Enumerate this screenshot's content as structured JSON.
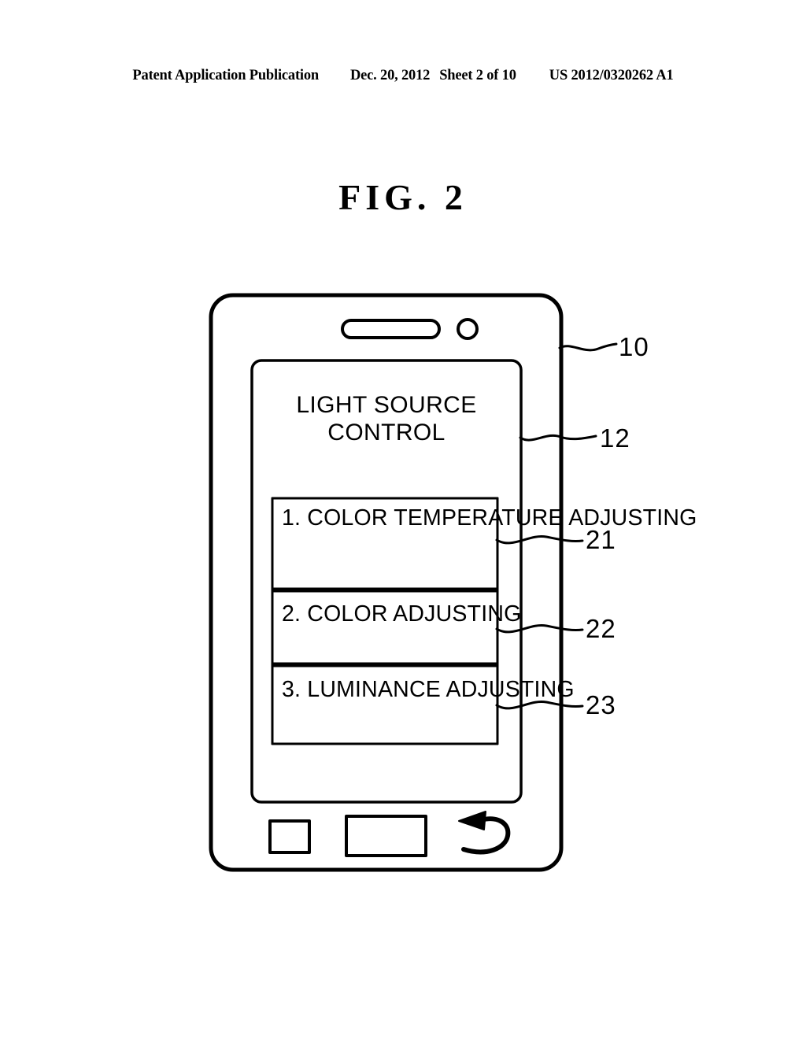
{
  "header": {
    "publication": "Patent Application Publication",
    "date": "Dec. 20, 2012",
    "sheet": "Sheet 2 of 10",
    "patent_number": "US 2012/0320262 A1"
  },
  "figure": {
    "title": "FIG.  2"
  },
  "device": {
    "label": "10",
    "screen": {
      "label": "12",
      "title": "LIGHT SOURCE\nCONTROL",
      "menu": [
        {
          "label": "1. COLOR TEMPERATURE ADJUSTING",
          "ref": "21"
        },
        {
          "label": "2. COLOR ADJUSTING",
          "ref": "22"
        },
        {
          "label": "3. LUMINANCE ADJUSTING",
          "ref": "23"
        }
      ]
    },
    "hardware": {
      "speaker": "speaker-slot",
      "camera": "camera-lens",
      "buttons": [
        "menu-button-square",
        "home-button-rectangle",
        "back-button-arrow"
      ]
    }
  },
  "style": {
    "ink": "#000000",
    "paper": "#ffffff"
  }
}
